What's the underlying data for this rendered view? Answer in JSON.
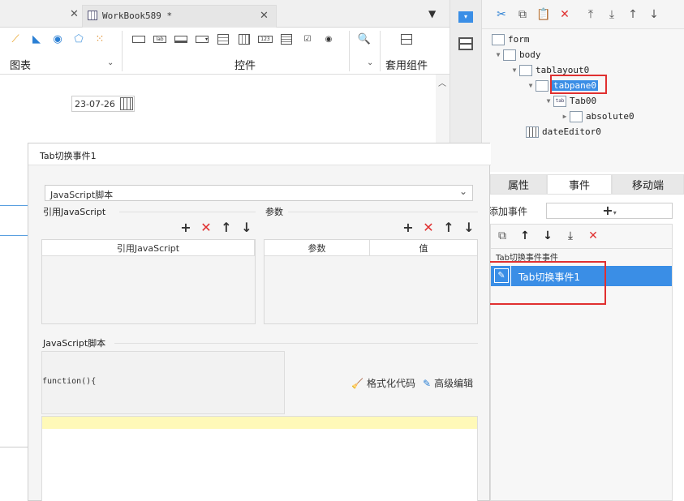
{
  "tabs": {
    "workbook_label": "WorkBook589 *"
  },
  "ribbon": {
    "group_chart": "图表",
    "group_widgets": "控件",
    "group_templates": "套用组件"
  },
  "canvas": {
    "date_value": "23-07-26"
  },
  "tree": {
    "form": "form",
    "body": "body",
    "tablayout": "tablayout0",
    "tabpane": "tabpane0",
    "tab00": "Tab00",
    "absolute": "absolute0",
    "dateeditor": "dateEditor0"
  },
  "panel_tabs": {
    "properties": "属性",
    "events": "事件",
    "mobile": "移动端"
  },
  "events": {
    "add_label": "添加事件",
    "add_plus": "+",
    "category": "Tab切换事件事件",
    "item": "Tab切换事件1"
  },
  "dialog": {
    "title": "Tab切换事件1",
    "type_value": "JavaScript脚本",
    "ref_js_label": "引用JavaScript",
    "params_label": "参数",
    "ref_js_col": "引用JavaScript",
    "params_col": "参数",
    "value_col": "值",
    "script_label": "JavaScript脚本",
    "function_text": "function(){",
    "format_code": "格式化代码",
    "advanced_edit": "高级编辑"
  },
  "colors": {
    "selection": "#3a8ee6",
    "highlight_box": "#e03030",
    "delete_red": "#e03030",
    "code_line": "#fff9b8"
  }
}
